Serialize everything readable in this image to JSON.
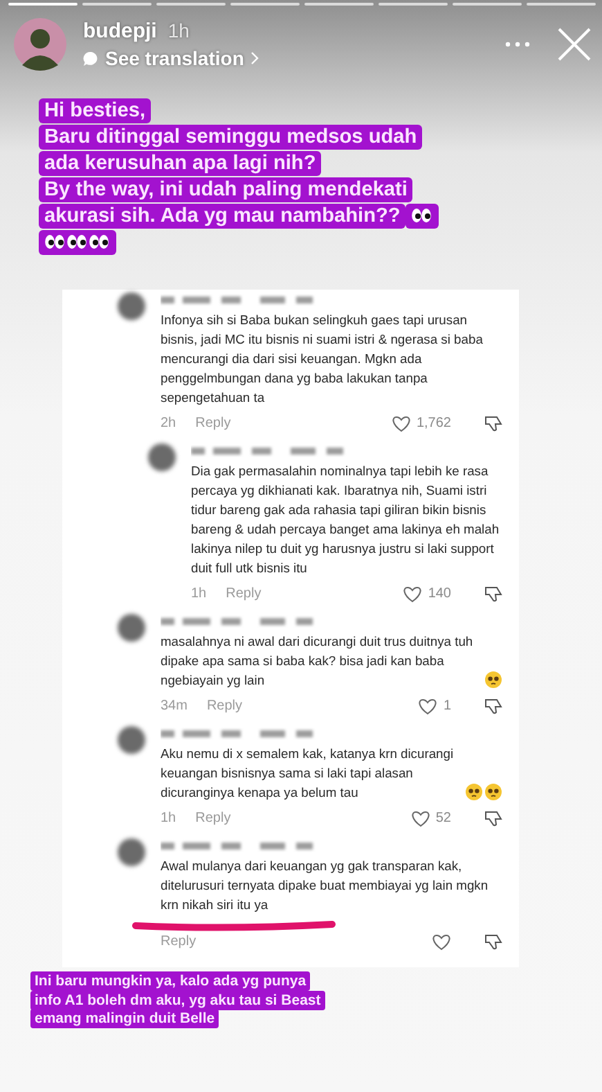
{
  "story": {
    "username": "budepji",
    "time": "1h",
    "translate_link": "See translation"
  },
  "caption": {
    "lines": [
      {
        "text": "Hi besties,"
      },
      {
        "text": "Baru ditinggal seminggu medsos udah"
      },
      {
        "text": "ada kerusuhan apa lagi nih?"
      },
      {
        "text": "By the way, ini udah paling mendekati"
      },
      {
        "text": "akurasi sih. Ada yg mau nambahin??",
        "emoji": [
          {
            "kind": "eyes"
          }
        ]
      },
      {
        "emoji": [
          {
            "kind": "eyes"
          },
          {
            "kind": "eyes"
          },
          {
            "kind": "eyes"
          }
        ]
      }
    ]
  },
  "comments": [
    {
      "kind": "comment",
      "text": "Infonya sih si Baba bukan selingkuh gaes tapi urusan bisnis, jadi MC itu bisnis ni suami istri & ngerasa si baba mencurangi dia dari sisi keuangan. Mgkn ada penggelmbungan dana yg baba lakukan tanpa sepengetahuan ta",
      "time": "2h",
      "reply": "Reply",
      "likes": "1,762"
    },
    {
      "kind": "reply",
      "text": "Dia gak permasalahin nominalnya tapi lebih ke rasa percaya yg dikhianati kak. Ibaratnya nih, Suami istri tidur bareng gak ada rahasia tapi giliran bikin bisnis bareng & udah percaya banget ama lakinya eh malah lakinya nilep tu duit yg harusnya justru si laki support duit full utk bisnis itu",
      "time": "1h",
      "reply": "Reply",
      "likes": "140"
    },
    {
      "kind": "comment",
      "text": "masalahnya ni awal dari dicurangi duit trus duitnya tuh dipake apa sama si baba kak? bisa jadi kan baba ngebiayain yg lain",
      "emoji": [
        {
          "kind": "pleading"
        }
      ],
      "time": "34m",
      "reply": "Reply",
      "likes": "1"
    },
    {
      "kind": "comment",
      "text": "Aku nemu di x semalem kak, katanya krn dicurangi keuangan bisnisnya sama si laki tapi alasan dicuranginya kenapa ya belum tau",
      "emoji": [
        {
          "kind": "pleading"
        },
        {
          "kind": "pleading"
        }
      ],
      "time": "1h",
      "reply": "Reply",
      "likes": "52"
    },
    {
      "kind": "comment",
      "text": "Awal mulanya dari keuangan yg gak transparan kak, ditelurusuri ternyata dipake buat membiayai yg lain mgkn krn nikah siri itu ya",
      "reply": "Reply",
      "underlined": true
    }
  ],
  "note": {
    "lines": [
      "Ini baru mungkin ya, kalo ada yg punya",
      "info A1 boleh dm aku, yg aku tau si Beast",
      "emang malingin duit Belle"
    ]
  }
}
